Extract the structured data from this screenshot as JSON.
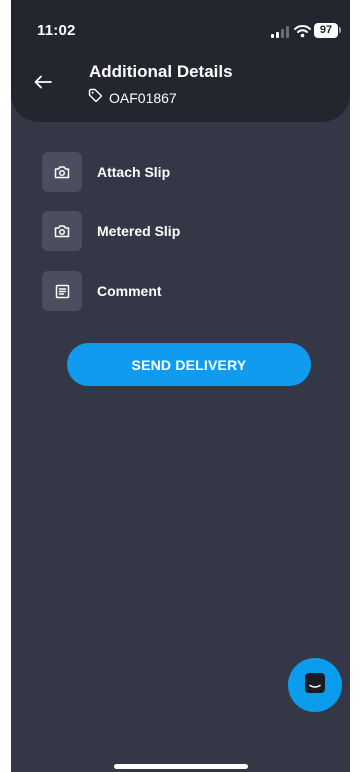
{
  "status_bar": {
    "time": "11:02",
    "battery": "97",
    "signal_icon": "cellular-signal-icon",
    "wifi_icon": "wifi-icon"
  },
  "header": {
    "back_icon": "arrow-left-icon",
    "title": "Additional Details",
    "tag_icon": "tag-icon",
    "order_id": "OAF01867"
  },
  "options": [
    {
      "label": "Attach Slip",
      "icon": "camera-icon"
    },
    {
      "label": "Metered Slip",
      "icon": "camera-icon"
    },
    {
      "label": "Comment",
      "icon": "document-icon"
    }
  ],
  "actions": {
    "send_label": "SEND DELIVERY"
  },
  "chat": {
    "icon": "chat-icon"
  },
  "colors": {
    "background": "#343746",
    "header": "#23252f",
    "icon_tile": "#4b4e5f",
    "accent": "#109bef"
  }
}
